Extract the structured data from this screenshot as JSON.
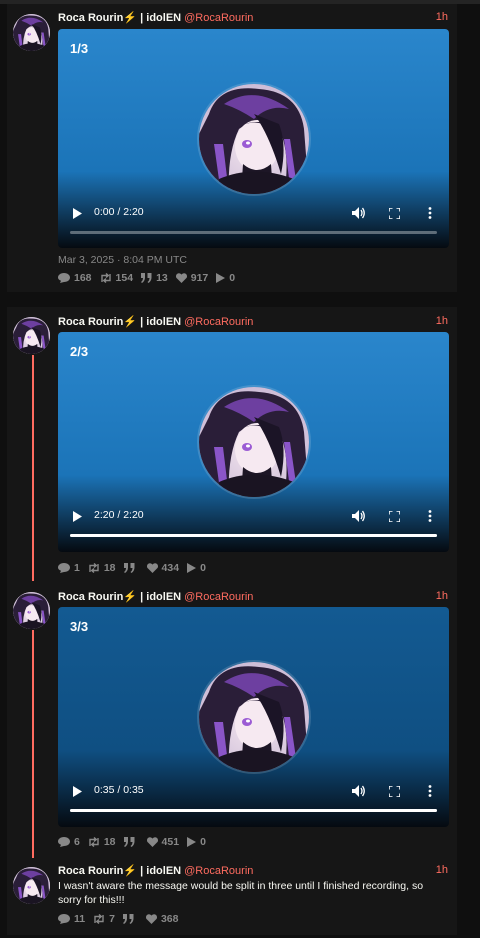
{
  "colors": {
    "accent": "#ff6c60",
    "panel": "#161616",
    "muted": "#888888"
  },
  "tweets": [
    {
      "fullname": "Roca Rourin⚡ | idolEN",
      "username": "@RocaRourin",
      "time": "1h",
      "video": {
        "counter": "1/3",
        "time": "0:00 / 2:20",
        "progress": 0.0
      },
      "date": "Mar 3, 2025 · 8:04 PM UTC",
      "stats": {
        "replies": "168",
        "retweets": "154",
        "quotes": "13",
        "likes": "917",
        "views": "0"
      }
    },
    {
      "fullname": "Roca Rourin⚡ | idolEN",
      "username": "@RocaRourin",
      "time": "1h",
      "video": {
        "counter": "2/3",
        "time": "2:20 / 2:20",
        "progress": 1.0
      },
      "stats": {
        "replies": "1",
        "retweets": "18",
        "quotes": "",
        "likes": "434",
        "views": "0"
      }
    },
    {
      "fullname": "Roca Rourin⚡ | idolEN",
      "username": "@RocaRourin",
      "time": "1h",
      "video": {
        "counter": "3/3",
        "time": "0:35 / 0:35",
        "progress": 1.0
      },
      "stats": {
        "replies": "6",
        "retweets": "18",
        "quotes": "",
        "likes": "451",
        "views": "0"
      }
    },
    {
      "fullname": "Roca Rourin⚡ | idolEN",
      "username": "@RocaRourin",
      "time": "1h",
      "text": "I wasn't aware the message would be split in three until I finished recording, so sorry for this!!!",
      "stats": {
        "replies": "11",
        "retweets": "7",
        "quotes": "",
        "likes": "368"
      }
    }
  ]
}
